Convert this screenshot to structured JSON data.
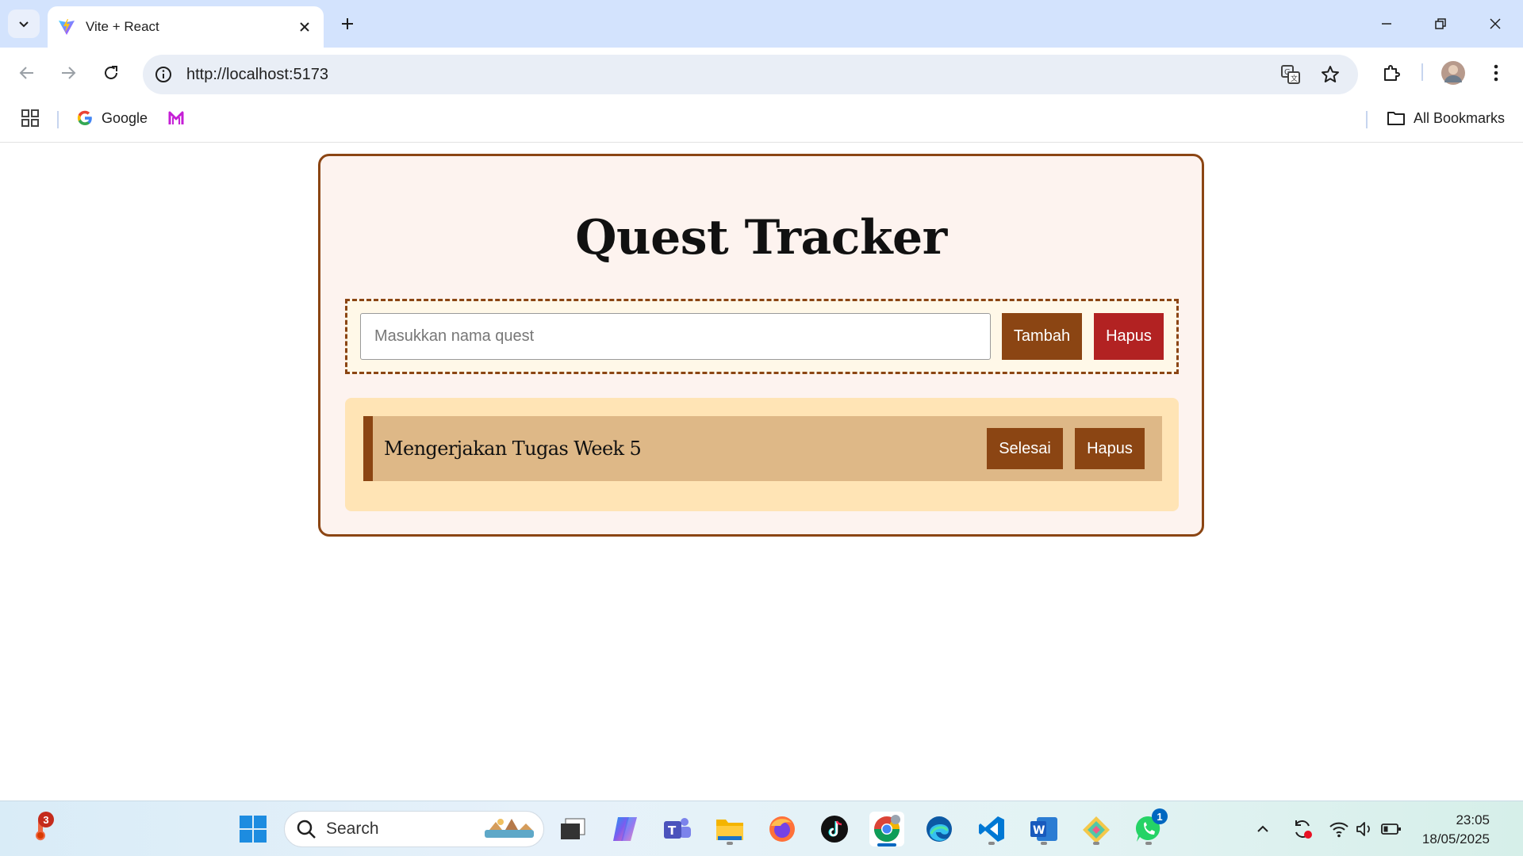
{
  "browser": {
    "tab_title": "Vite + React",
    "url": "http://localhost:5173",
    "bookmarks": [
      {
        "label": "Google",
        "icon": "google-icon"
      },
      {
        "label": "",
        "icon": "m-logo-icon"
      }
    ],
    "all_bookmarks_label": "All Bookmarks"
  },
  "app": {
    "title": "Quest Tracker",
    "input_placeholder": "Masukkan nama quest",
    "input_value": "",
    "add_label": "Tambah",
    "clear_label": "Hapus",
    "quests": [
      {
        "name": "Mengerjakan Tugas Week 5",
        "done_label": "Selesai",
        "delete_label": "Hapus"
      }
    ],
    "colors": {
      "accent": "#8b4513",
      "danger": "#b22222",
      "card_bg": "#fdf3ef",
      "list_bg": "#ffe4b5",
      "item_bg": "#deb887"
    }
  },
  "taskbar": {
    "search_label": "Search",
    "weather_badge": "3",
    "whatsapp_badge": "1",
    "time": "23:05",
    "date": "18/05/2025",
    "apps": [
      "start-icon",
      "search-icon",
      "task-view-icon",
      "copilot-icon",
      "teams-icon",
      "file-explorer-icon",
      "firefox-icon",
      "tiktok-icon",
      "chrome-icon",
      "edge-icon",
      "vscode-icon",
      "word-icon",
      "git-icon",
      "whatsapp-icon"
    ]
  }
}
